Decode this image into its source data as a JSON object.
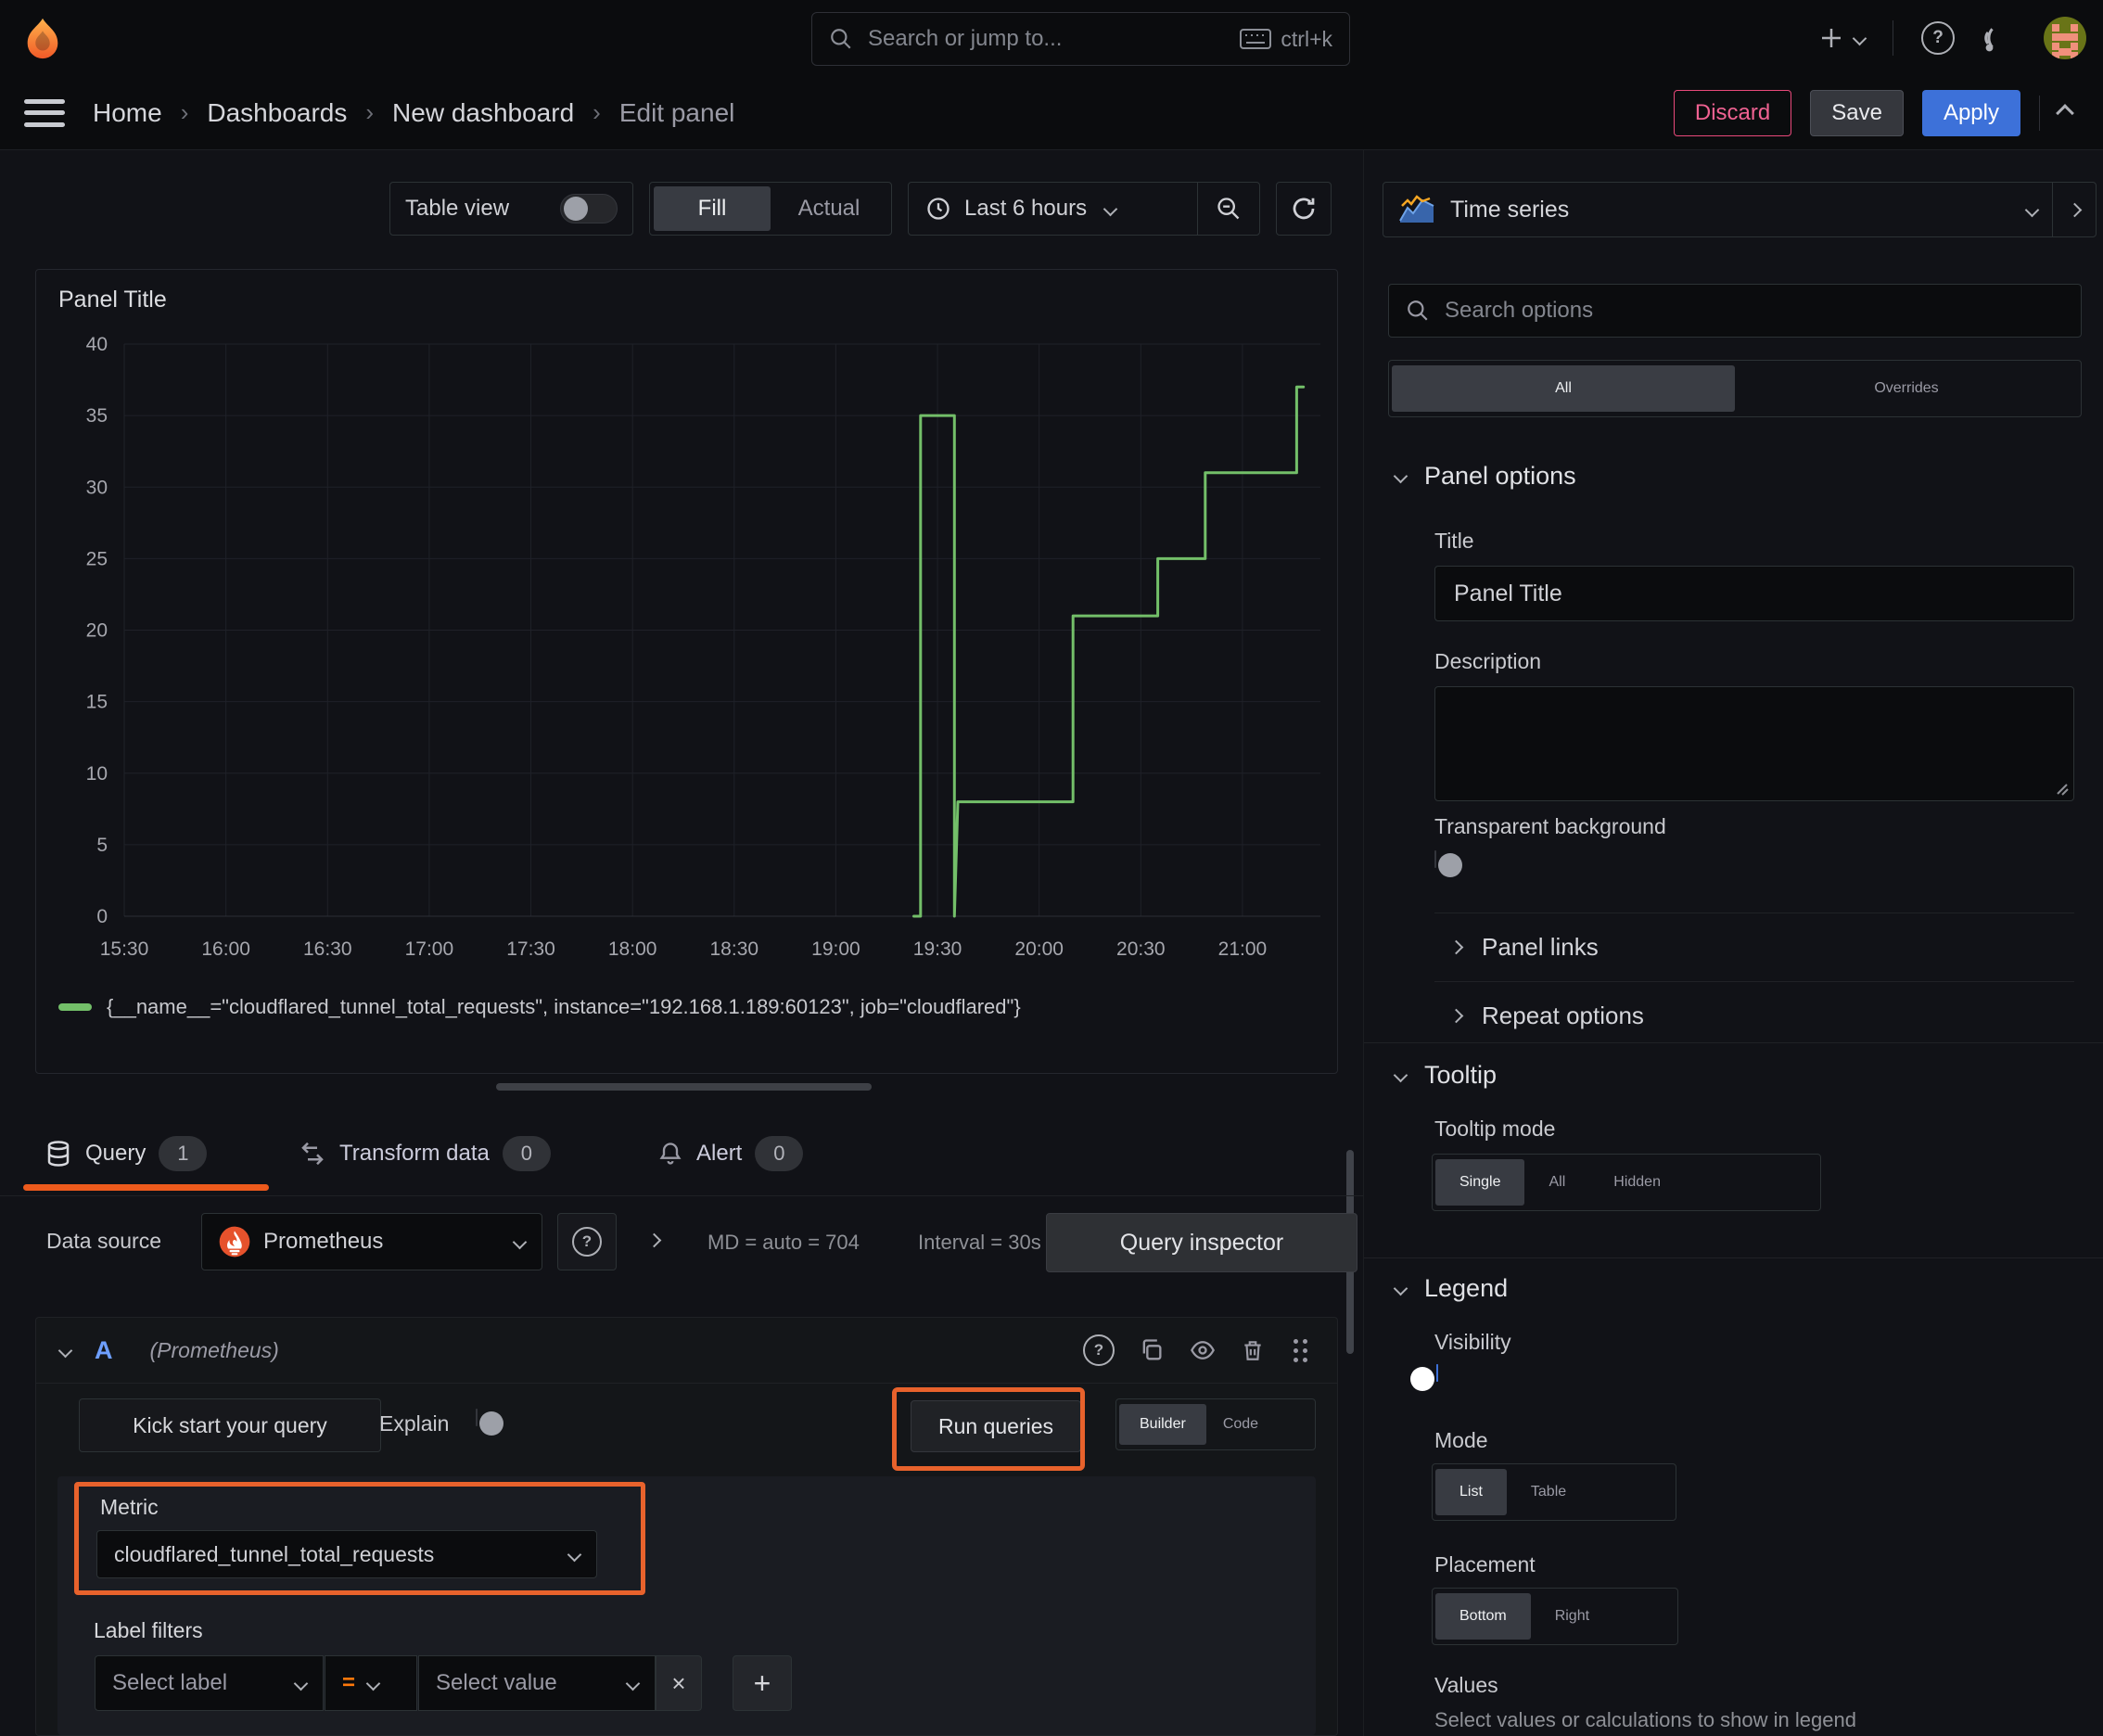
{
  "topnav": {
    "search_placeholder": "Search or jump to...",
    "shortcut": "ctrl+k"
  },
  "breadcrumb": {
    "separator": "›",
    "items": [
      "Home",
      "Dashboards",
      "New dashboard",
      "Edit panel"
    ]
  },
  "actions": {
    "discard": "Discard",
    "save": "Save",
    "apply": "Apply"
  },
  "toolbar": {
    "table_view": "Table view",
    "fill": "Fill",
    "actual": "Actual",
    "time_range": "Last 6 hours"
  },
  "viz_picker": {
    "label": "Time series"
  },
  "panel": {
    "title": "Panel Title"
  },
  "chart_data": {
    "type": "line",
    "title": "Panel Title",
    "x_unit": "minutes after 15:30",
    "x_range_minutes": [
      0,
      353
    ],
    "x_tick_minutes": [
      0,
      30,
      60,
      90,
      120,
      150,
      180,
      210,
      240,
      270,
      300,
      330
    ],
    "x_ticks": [
      "15:30",
      "16:00",
      "16:30",
      "17:00",
      "17:30",
      "18:00",
      "18:30",
      "19:00",
      "19:30",
      "20:00",
      "20:30",
      "21:00"
    ],
    "y_ticks": [
      0,
      5,
      10,
      15,
      20,
      25,
      30,
      35,
      40
    ],
    "ylim": [
      0,
      40
    ],
    "grid": true,
    "legend_position": "bottom",
    "series": [
      {
        "name": "{__name__=\"cloudflared_tunnel_total_requests\", instance=\"192.168.1.189:60123\", job=\"cloudflared\"}",
        "color": "#73BF69",
        "step": true,
        "points": [
          [
            233,
            0
          ],
          [
            235,
            0
          ],
          [
            235,
            35
          ],
          [
            245,
            35
          ],
          [
            245,
            0
          ],
          [
            246,
            8
          ],
          [
            280,
            8
          ],
          [
            280,
            21
          ],
          [
            305,
            21
          ],
          [
            305,
            25
          ],
          [
            319,
            25
          ],
          [
            319,
            31
          ],
          [
            346,
            31
          ],
          [
            346,
            37
          ],
          [
            348,
            37
          ]
        ]
      }
    ]
  },
  "tabs": {
    "query": {
      "label": "Query",
      "count": "1"
    },
    "transform": {
      "label": "Transform data",
      "count": "0"
    },
    "alert": {
      "label": "Alert",
      "count": "0"
    }
  },
  "datasource_row": {
    "label": "Data source",
    "name": "Prometheus",
    "stats_md": "MD = auto = 704",
    "stats_interval": "Interval = 30s",
    "inspector": "Query inspector"
  },
  "query_editor": {
    "ref_id": "A",
    "ds_hint": "(Prometheus)",
    "kick_start": "Kick start your query",
    "explain": "Explain",
    "run_queries": "Run queries",
    "builder": "Builder",
    "code": "Code",
    "metric_label": "Metric",
    "metric_value": "cloudflared_tunnel_total_requests",
    "label_filters_label": "Label filters",
    "select_label": "Select label",
    "operator": "=",
    "select_value": "Select value",
    "remove": "×",
    "add": "+"
  },
  "options_panel": {
    "search_placeholder": "Search options",
    "tab_all": "All",
    "tab_overrides": "Overrides",
    "panel_options": {
      "title": "Panel options",
      "title_label": "Title",
      "title_value": "Panel Title",
      "description_label": "Description",
      "transparent_label": "Transparent background",
      "panel_links": "Panel links",
      "repeat_options": "Repeat options"
    },
    "tooltip": {
      "title": "Tooltip",
      "mode_label": "Tooltip mode",
      "modes": [
        "Single",
        "All",
        "Hidden"
      ],
      "selected": "Single"
    },
    "legend": {
      "title": "Legend",
      "visibility_label": "Visibility",
      "mode_label": "Mode",
      "modes": [
        "List",
        "Table"
      ],
      "selected_mode": "List",
      "placement_label": "Placement",
      "placements": [
        "Bottom",
        "Right"
      ],
      "selected_placement": "Bottom",
      "values_label": "Values",
      "values_hint": "Select values or calculations to show in legend"
    }
  },
  "colors": {
    "series_green": "#73BF69",
    "annotation_orange": "#E8622C",
    "tab_underline_orange": "#ED5A1C",
    "apply_blue": "#3D71D9",
    "discard_pink": "#E8497A",
    "operator_orange": "#FF780A"
  }
}
